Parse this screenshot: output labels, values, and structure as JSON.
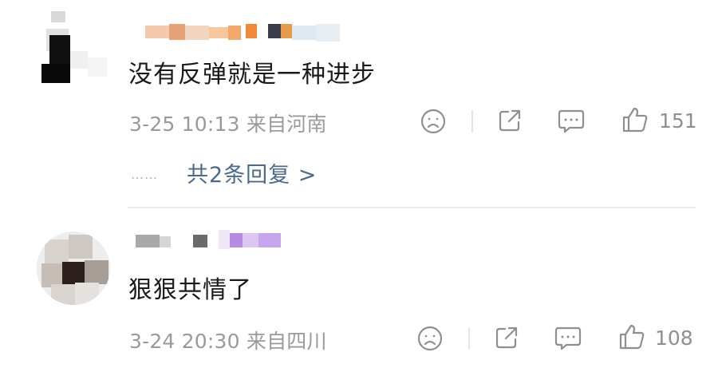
{
  "comments": [
    {
      "text": "没有反弹就是一种进步",
      "date": "3-25 10:13",
      "location": "来自河南",
      "likes": "151",
      "replies_link": "共2条回复 >",
      "replies_dots": "……"
    },
    {
      "text": "狠狠共情了",
      "date": "3-24 20:30",
      "location": "来自四川",
      "likes": "108"
    }
  ],
  "icons": {
    "dislike": "sad-face-icon",
    "share": "share-icon",
    "comment": "comment-bubble-icon",
    "like": "thumbs-up-icon"
  },
  "colors": {
    "link": "#4a6a8f",
    "meta": "#9a9a9a",
    "text": "#1a1a1a"
  }
}
